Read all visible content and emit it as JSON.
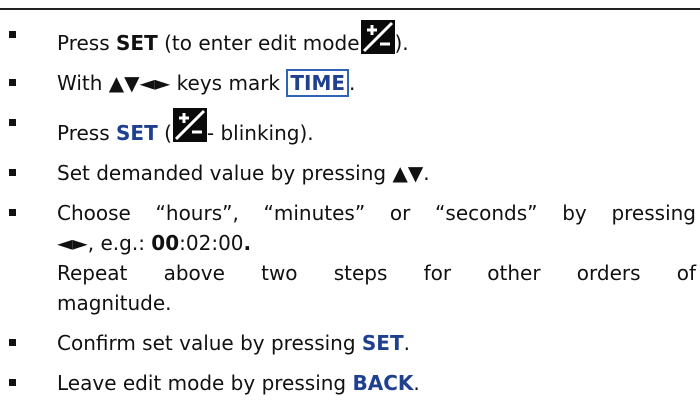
{
  "steps": [
    {
      "parts": [
        "Press ",
        "SET",
        " (to enter edit mode",
        ")."
      ]
    },
    {
      "parts": [
        "With  ",
        "▲▼◄►",
        " keys mark ",
        "TIME",
        "."
      ]
    },
    {
      "parts": [
        "Press ",
        "SET",
        " (",
        "- blinking)."
      ]
    },
    {
      "parts": [
        "Set demanded value by pressing ",
        "▲▼",
        "."
      ]
    },
    {
      "parts": [
        "Choose “hours”, “minutes” or “seconds” by pressing",
        "◄►",
        ", e.g.: ",
        "00",
        ":02:00",
        ".",
        "Repeat above two steps for other orders of",
        "magnitude."
      ]
    },
    {
      "parts": [
        "Confirm set value by pressing ",
        "SET",
        "."
      ]
    },
    {
      "parts": [
        "Leave edit mode by pressing ",
        "BACK",
        "."
      ]
    }
  ],
  "icons": {
    "edit_mode": "plus-minus-edit-icon"
  }
}
